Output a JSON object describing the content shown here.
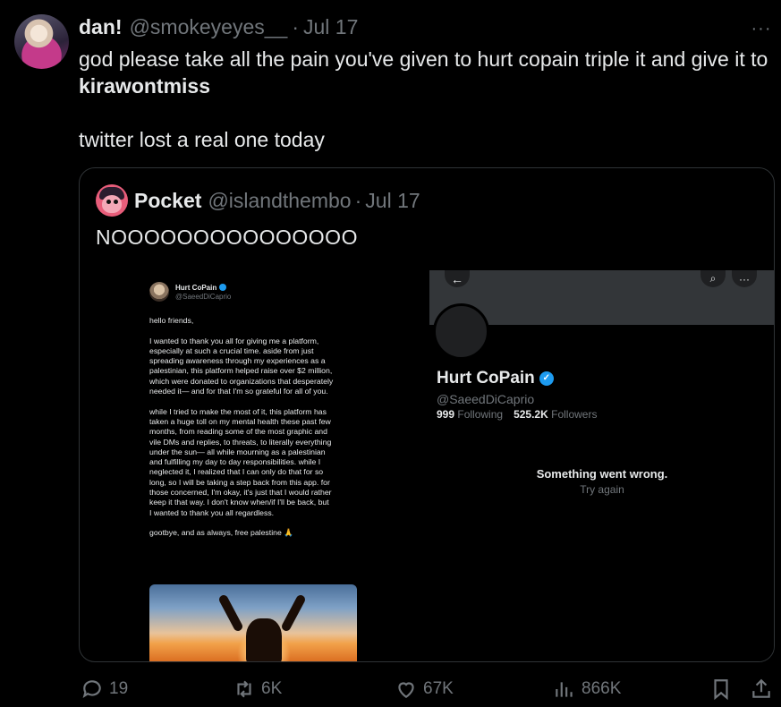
{
  "tweet": {
    "author_name": "dan!",
    "author_handle": "@smokeyeyes__",
    "separator": "·",
    "date": "Jul 17",
    "more_icon": "more-horizontal-icon",
    "text_line1": "god please take all the pain you've given to hurt copain triple it and give it to",
    "text_line2": "kirawontmiss",
    "text_line3": "twitter lost a real one today"
  },
  "quote": {
    "author_name": "Pocket",
    "author_handle": "@islandthembo",
    "separator": "·",
    "date": "Jul 17",
    "text": "NOOOOOOOOOOOOOOO"
  },
  "notes_image": {
    "name": "Hurt CoPain",
    "handle": "@SaeedDiCaprio",
    "p1": "hello friends,",
    "p2": "I wanted to thank you all for giving me a platform,\nespecially at such a crucial time. aside from just\nspreading awareness through my experiences as a\npalestinian, this platform helped raise over $2 million,\nwhich were donated to organizations that desperately\nneeded it— and for that I'm so grateful for all of you.",
    "p3": "while I tried to make the most of it, this platform has\ntaken a huge toll on my mental health these past few\nmonths, from reading some of the most graphic and\nvile DMs and replies, to threats, to literally everything\nunder the sun— all while mourning as a palestinian\nand fulfilling my day to day responsibilities. while I\nneglected it, I realized that I can only do that for so\nlong, so I will be taking a step back from this app. for\nthose concerned, I'm okay, it's just that I would rather\nkeep it that way. I don't know when/if I'll be back, but\nI wanted to thank you all regardless.",
    "p4": "gootbye, and as always, free palestine 🙏"
  },
  "profile_image": {
    "name": "Hurt CoPain",
    "handle": "@SaeedDiCaprio",
    "following_count": "999",
    "following_label": "Following",
    "followers_count": "525.2K",
    "followers_label": "Followers",
    "error": "Something went wrong.",
    "retry": "Try again",
    "back_icon": "←",
    "search_icon": "⌕",
    "more_icon": "···"
  },
  "actions": {
    "replies": "19",
    "reposts": "6K",
    "likes": "67K",
    "views": "866K"
  }
}
